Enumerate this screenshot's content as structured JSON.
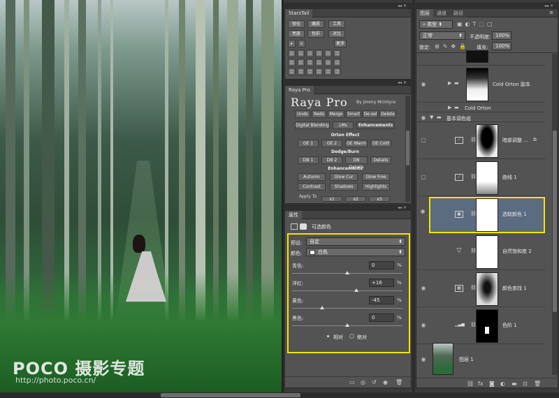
{
  "photo": {
    "watermark_logo": "POCO 摄影专题",
    "watermark_url": "http://photo.poco.cn/"
  },
  "starstail": {
    "title": "StarsTail",
    "row1": [
      "锐化",
      "磨皮",
      "工具"
    ],
    "row2": [
      "亮度",
      "色彩",
      "对比"
    ],
    "more": "更多"
  },
  "raya": {
    "tab": "Raya Pro",
    "logo": "Raya Pro",
    "byline": "By Jimmy McIntyre",
    "row1": [
      "Undo",
      "Redo",
      "Merge",
      "Smart",
      "De-sel",
      "Delete"
    ],
    "tabs": [
      "Digital Blending",
      "LMs",
      "Enhancements"
    ],
    "orton_head": "Orton Effect",
    "orton": [
      "OE 1",
      "OE 2",
      "OE Warm",
      "OE Cold"
    ],
    "dodge_head": "Dodge/Burn",
    "dodge": [
      "DB 1",
      "DB 2",
      "DB Details",
      "Details"
    ],
    "enh_head": "Enhancements",
    "enh1": [
      "Autumn",
      "Glow Cur",
      "Glow Free"
    ],
    "enh2": [
      "Contrast",
      "Shadows",
      "Highlights"
    ],
    "apply_to": "Apply To",
    "apply": [
      "x1",
      "x2",
      "x3"
    ]
  },
  "properties": {
    "tab": "属性",
    "type_label": "可选颜色",
    "preset_label": "预设:",
    "preset_value": "自定",
    "color_label": "颜色:",
    "color_value": "白色",
    "sliders": [
      {
        "label": "青色:",
        "value": "0",
        "unit": "%",
        "pos": 0.5
      },
      {
        "label": "洋红:",
        "value": "+16",
        "unit": "%",
        "pos": 0.58
      },
      {
        "label": "黄色:",
        "value": "-45",
        "unit": "%",
        "pos": 0.275
      },
      {
        "label": "黑色:",
        "value": "0",
        "unit": "%",
        "pos": 0.5
      }
    ],
    "mode_relative": "相对",
    "mode_absolute": "绝对"
  },
  "layers": {
    "tabs": [
      "图层",
      "通道",
      "路径"
    ],
    "filter_label": "类型",
    "blend_mode": "正常",
    "opacity_label": "不透明度:",
    "opacity_value": "100%",
    "lock_label": "锁定:",
    "fill_label": "填充:",
    "fill_value": "100%",
    "items": [
      {
        "name": "Cold Orton 副本"
      },
      {
        "name": "Cold Orton"
      },
      {
        "name": "基本调色组"
      },
      {
        "name": "暗部调整 ..."
      },
      {
        "name": "曲线 1"
      },
      {
        "name": "选取颜色 1"
      },
      {
        "name": "自然饱和度 2"
      },
      {
        "name": "颜色查找 1"
      },
      {
        "name": "色阶 1"
      },
      {
        "name": "图层 1"
      }
    ]
  },
  "colors": {
    "highlight": "#f2e600",
    "selected_layer": "#5b6b80"
  }
}
